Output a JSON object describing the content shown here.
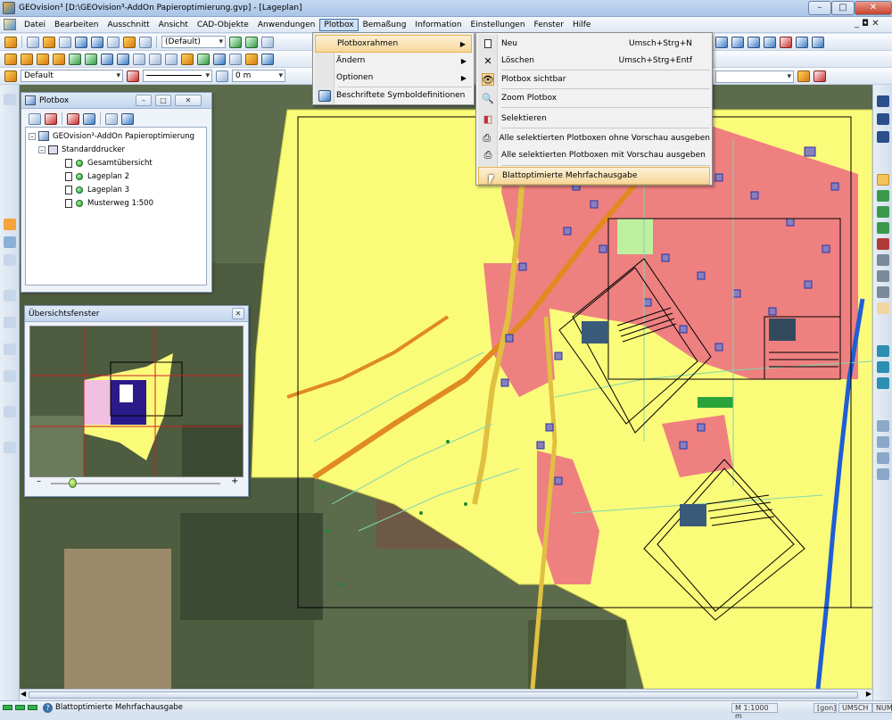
{
  "window": {
    "title": "GEOvision³  [D:\\GEOvision³-AddOn Papieroptimierung.gvp] - [Lageplan]",
    "minimize": "–",
    "maximize": "□",
    "close": "✕"
  },
  "menubar": {
    "items": [
      "Datei",
      "Bearbeiten",
      "Ausschnitt",
      "Ansicht",
      "CAD-Objekte",
      "Anwendungen",
      "Plotbox",
      "Bemaßung",
      "Information",
      "Einstellungen",
      "Fenster",
      "Hilfe"
    ],
    "active": "Plotbox",
    "mdi_controls": "_ ◘ ✕"
  },
  "toolbars": {
    "combo_default_1": "(Default)",
    "combo_default_2": "Default",
    "combo_offset": "0 m"
  },
  "plotbox_menu": {
    "items": [
      {
        "label": "Plotboxrahmen",
        "submenu": true
      },
      {
        "label": "Ändern",
        "submenu": true
      },
      {
        "label": "Optionen",
        "submenu": true
      },
      {
        "label": "Beschriftete Symboldefinitionen",
        "submenu": false
      }
    ]
  },
  "plotboxrahmen_submenu": {
    "items": [
      {
        "label": "Neu",
        "shortcut": "Umsch+Strg+N",
        "icon": "new-doc-icon"
      },
      {
        "label": "Löschen",
        "shortcut": "Umsch+Strg+Entf",
        "icon": "delete-x-icon"
      },
      {
        "label": "Plotbox sichtbar",
        "shortcut": "",
        "icon": "eye-icon"
      },
      {
        "label": "Zoom Plotbox",
        "shortcut": "",
        "icon": "zoom-icon"
      },
      {
        "label": "Selektieren",
        "shortcut": "",
        "icon": "select-icon"
      },
      {
        "label": "Alle selektierten Plotboxen ohne Vorschau ausgeben",
        "shortcut": "",
        "icon": "printer-icon"
      },
      {
        "label": "Alle selektierten Plotboxen mit Vorschau ausgeben",
        "shortcut": "",
        "icon": "printer-preview-icon"
      },
      {
        "label": "Blattoptimierte Mehrfachausgabe",
        "shortcut": "",
        "icon": ""
      }
    ],
    "highlighted": "Blattoptimierte Mehrfachausgabe"
  },
  "plotbox_panel": {
    "title": "Plotbox",
    "tree": {
      "root": "GEOvision³-AddOn Papieroptimierung",
      "printer": "Standarddrucker",
      "items": [
        "Gesamtübersicht",
        "Lageplan 2",
        "Lageplan 3",
        "Musterweg 1:500"
      ]
    }
  },
  "overview_panel": {
    "title": "Übersichtsfenster",
    "zoom_minus": "–",
    "zoom_plus": "+"
  },
  "statusbar": {
    "message": "Blattoptimierte Mehrfachausgabe",
    "scale": "M 1:1000",
    "scale_unit": "m",
    "angle_unit": "[gon]",
    "umsch": "UMSCH",
    "num": "NUM"
  },
  "colors": {
    "accent": "#3a6ea5",
    "map_yellow": "#fbfb7a",
    "map_red": "#ef7a7a",
    "map_orange": "#e8a23a",
    "map_blue_road": "#1f5ed6"
  }
}
